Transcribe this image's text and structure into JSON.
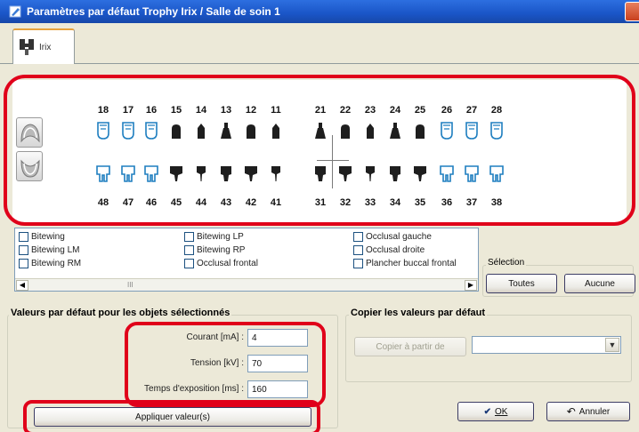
{
  "window": {
    "title": "Paramètres par défaut  Trophy Irix / Salle de soin 1",
    "tab_label": "Irix"
  },
  "teeth": {
    "upper_numbers": [
      "18",
      "17",
      "16",
      "15",
      "14",
      "13",
      "12",
      "11",
      "21",
      "22",
      "23",
      "24",
      "25",
      "26",
      "27",
      "28"
    ],
    "lower_numbers": [
      "48",
      "47",
      "46",
      "45",
      "44",
      "43",
      "42",
      "41",
      "31",
      "32",
      "33",
      "34",
      "35",
      "36",
      "37",
      "38"
    ],
    "upper_states": [
      "outline",
      "outline",
      "outline",
      "solid",
      "solid",
      "solid",
      "solid",
      "solid",
      "solid",
      "solid",
      "solid",
      "solid",
      "solid",
      "outline",
      "outline",
      "outline"
    ],
    "lower_states": [
      "outline",
      "outline",
      "outline",
      "solid",
      "solid",
      "solid",
      "solid",
      "solid",
      "solid",
      "solid",
      "solid",
      "solid",
      "solid",
      "outline",
      "outline",
      "outline"
    ],
    "buttons": {
      "upper_icon": "upper-jaw-icon",
      "lower_icon": "lower-jaw-icon"
    }
  },
  "exam_types": {
    "col1": [
      "Bitewing",
      "Bitewing LM",
      "Bitewing RM"
    ],
    "col2": [
      "Bitewing LP",
      "Bitewing RP",
      "Occlusal frontal"
    ],
    "col3": [
      "Occlusal gauche",
      "Occlusal droite",
      "Plancher buccal frontal"
    ],
    "scroll_mark": "III"
  },
  "selection": {
    "title": "Sélection",
    "all_label": "Toutes",
    "none_label": "Aucune"
  },
  "defaults": {
    "title": "Valeurs par défaut pour les objets sélectionnés",
    "current_label": "Courant [mA] :",
    "current_value": "4",
    "voltage_label": "Tension [kV] :",
    "voltage_value": "70",
    "exposure_label": "Temps d'exposition [ms] :",
    "exposure_value": "160",
    "apply_label": "Appliquer valeur(s)"
  },
  "copy": {
    "title": "Copier les valeurs par défaut",
    "copy_from_label": "Copier à partir de",
    "select_value": ""
  },
  "footer": {
    "ok_label": "OK",
    "cancel_label": "Annuler"
  },
  "colors": {
    "title_bar": "#1a55c7",
    "highlight": "#e0001a",
    "tooth_solid": "#1e1e1e",
    "tooth_outline": "#1f7fc0"
  }
}
